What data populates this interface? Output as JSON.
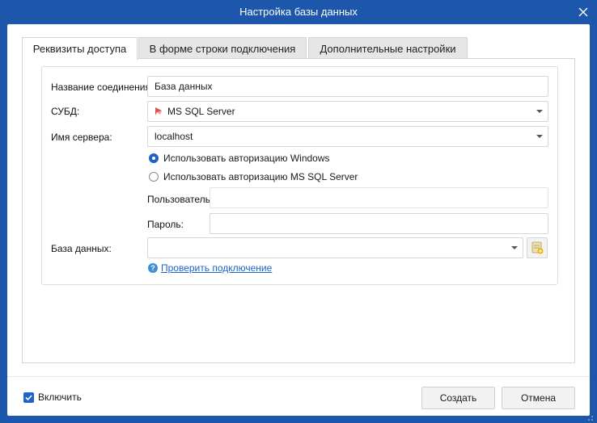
{
  "window": {
    "title": "Настройка базы данных",
    "close_icon": "close-icon"
  },
  "tabs": [
    {
      "label": "Реквизиты доступа",
      "active": true
    },
    {
      "label": "В форме строки подключения",
      "active": false
    },
    {
      "label": "Дополнительные настройки",
      "active": false
    }
  ],
  "form": {
    "connection_name_label": "Название соединения:",
    "connection_name_value": "База данных",
    "dbms_label": "СУБД:",
    "dbms_value": "MS SQL Server",
    "server_label": "Имя сервера:",
    "server_value": "localhost",
    "auth_windows_label": "Использовать авторизацию Windows",
    "auth_sql_label": "Использовать авторизацию MS SQL Server",
    "auth_selected": "windows",
    "user_label": "Пользователь:",
    "user_value": "",
    "password_label": "Пароль:",
    "password_value": "",
    "database_label": "База данных:",
    "database_value": "",
    "check_connection_link": "Проверить подключение"
  },
  "footer": {
    "enable_label": "Включить",
    "enable_checked": true,
    "create_button": "Создать",
    "cancel_button": "Отмена"
  },
  "colors": {
    "titlebar": "#1d57ab",
    "accent": "#1f63c6",
    "link": "#1b64c8"
  }
}
